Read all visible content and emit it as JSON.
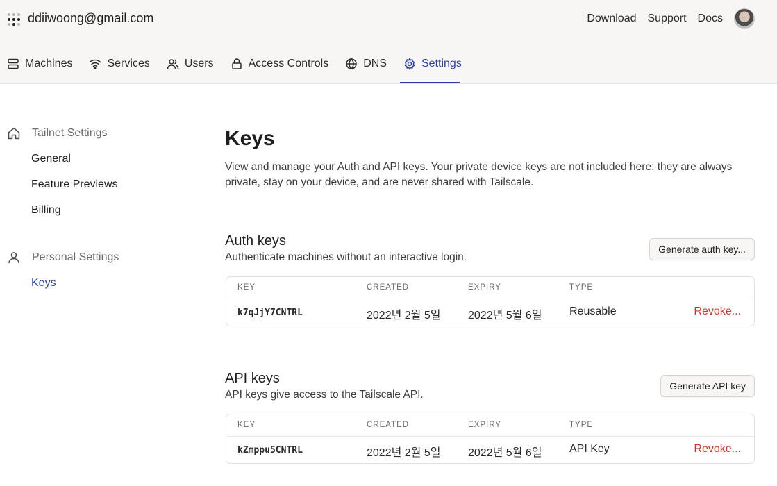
{
  "header": {
    "account": "ddiiwoong@gmail.com",
    "links": [
      "Download",
      "Support",
      "Docs"
    ]
  },
  "nav": {
    "items": [
      {
        "label": "Machines",
        "icon": "server-icon"
      },
      {
        "label": "Services",
        "icon": "wifi-icon"
      },
      {
        "label": "Users",
        "icon": "users-icon"
      },
      {
        "label": "Access Controls",
        "icon": "lock-icon"
      },
      {
        "label": "DNS",
        "icon": "globe-icon"
      },
      {
        "label": "Settings",
        "icon": "gear-icon"
      }
    ],
    "active": "Settings",
    "accent": "#2c3fa8"
  },
  "sidebar": {
    "tailnet_heading": "Tailnet Settings",
    "tailnet_items": [
      "General",
      "Feature Previews",
      "Billing"
    ],
    "personal_heading": "Personal Settings",
    "personal_items": [
      "Keys"
    ]
  },
  "page": {
    "title": "Keys",
    "description": "View and manage your Auth and API keys. Your private device keys are not included here: they are always private, stay on your device, and are never shared with Tailscale."
  },
  "auth_keys": {
    "title": "Auth keys",
    "subtitle": "Authenticate machines without an interactive login.",
    "button": "Generate auth key...",
    "columns": [
      "KEY",
      "CREATED",
      "EXPIRY",
      "TYPE"
    ],
    "rows": [
      {
        "key": "k7qJjY7CNTRL",
        "created": "2022년 2월 5일",
        "expiry": "2022년 5월 6일",
        "type": "Reusable",
        "action": "Revoke..."
      }
    ]
  },
  "api_keys": {
    "title": "API keys",
    "subtitle": "API keys give access to the Tailscale API.",
    "button": "Generate API key",
    "columns": [
      "KEY",
      "CREATED",
      "EXPIRY",
      "TYPE"
    ],
    "rows": [
      {
        "key": "kZmppu5CNTRL",
        "created": "2022년 2월 5일",
        "expiry": "2022년 5월 6일",
        "type": "API Key",
        "action": "Revoke..."
      }
    ]
  },
  "colors": {
    "revoke": "#c8372d",
    "background": "#f7f6f5"
  }
}
